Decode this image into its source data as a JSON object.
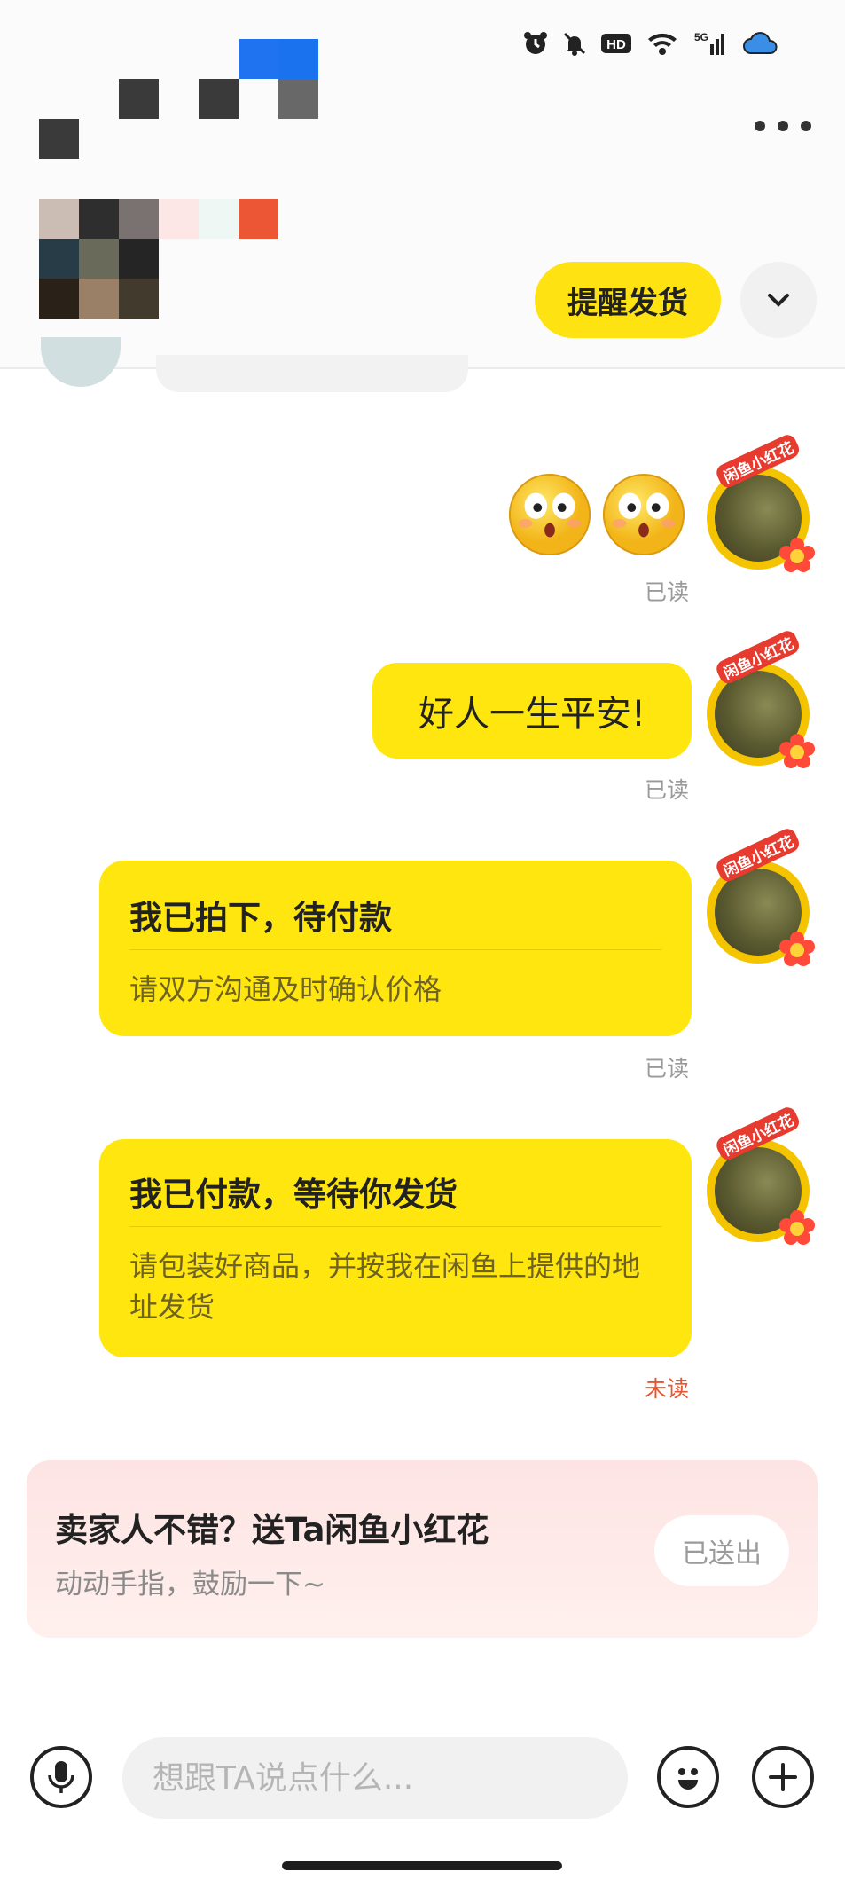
{
  "header": {
    "remind_button": "提醒发货"
  },
  "messages": [
    {
      "type": "emoji",
      "status": "已读"
    },
    {
      "type": "text",
      "text": "好人一生平安!",
      "status": "已读"
    },
    {
      "type": "card",
      "title": "我已拍下，待付款",
      "desc": "请双方沟通及时确认价格",
      "status": "已读"
    },
    {
      "type": "card",
      "title": "我已付款，等待你发货",
      "desc": "请包装好商品，并按我在闲鱼上提供的地址发货",
      "status": "未读"
    }
  ],
  "avatar_badge": "闲鱼小红花",
  "promo": {
    "title": "卖家人不错？送Ta闲鱼小红花",
    "subtitle": "动动手指，鼓励一下~",
    "button": "已送出"
  },
  "input": {
    "placeholder": "想跟TA说点什么..."
  },
  "colors": {
    "accent": "#ffe60f",
    "unread": "#e6562f",
    "read": "#9a9a9a"
  },
  "icons": [
    "alarm-icon",
    "mute-icon",
    "hd-icon",
    "wifi-icon",
    "signal-5g-icon",
    "cloud-icon",
    "more-icon",
    "chevron-down-icon",
    "voice-icon",
    "emoji-icon",
    "plus-icon"
  ]
}
